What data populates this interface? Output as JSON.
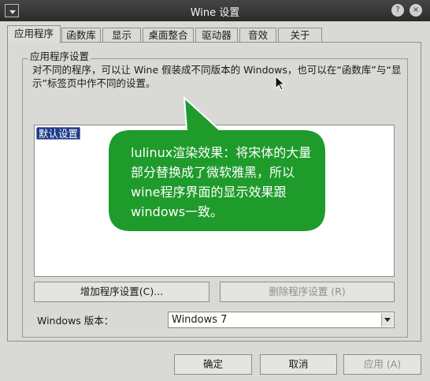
{
  "window": {
    "title": "Wine 设置",
    "help_glyph": "?",
    "close_glyph": "×"
  },
  "tabs": [
    {
      "label": "应用程序",
      "active": true
    },
    {
      "label": "函数库",
      "active": false
    },
    {
      "label": "显示",
      "active": false
    },
    {
      "label": "桌面整合",
      "active": false
    },
    {
      "label": "驱动器",
      "active": false
    },
    {
      "label": "音效",
      "active": false
    },
    {
      "label": "关于",
      "active": false
    }
  ],
  "app_settings": {
    "group_title": "应用程序设置",
    "description": "对不同的程序，可以让 Wine 假装成不同版本的 Windows，也可以在“函数库”与“显示”标签页中作不同的设置。",
    "list_items": [
      "默认设置"
    ],
    "add_button": "增加程序设置(C)...",
    "remove_button": "删除程序设置 (R)",
    "version_label": "Windows 版本：",
    "version_value": "Windows 7"
  },
  "annotation": {
    "text": "lulinux渲染效果：将宋体的大量部分替换成了微软雅黑，所以wine程序界面的显示效果跟windows一致。",
    "color": "#1e9b2b"
  },
  "footer": {
    "ok": "确定",
    "cancel": "取消",
    "apply": "应用 (A)"
  }
}
